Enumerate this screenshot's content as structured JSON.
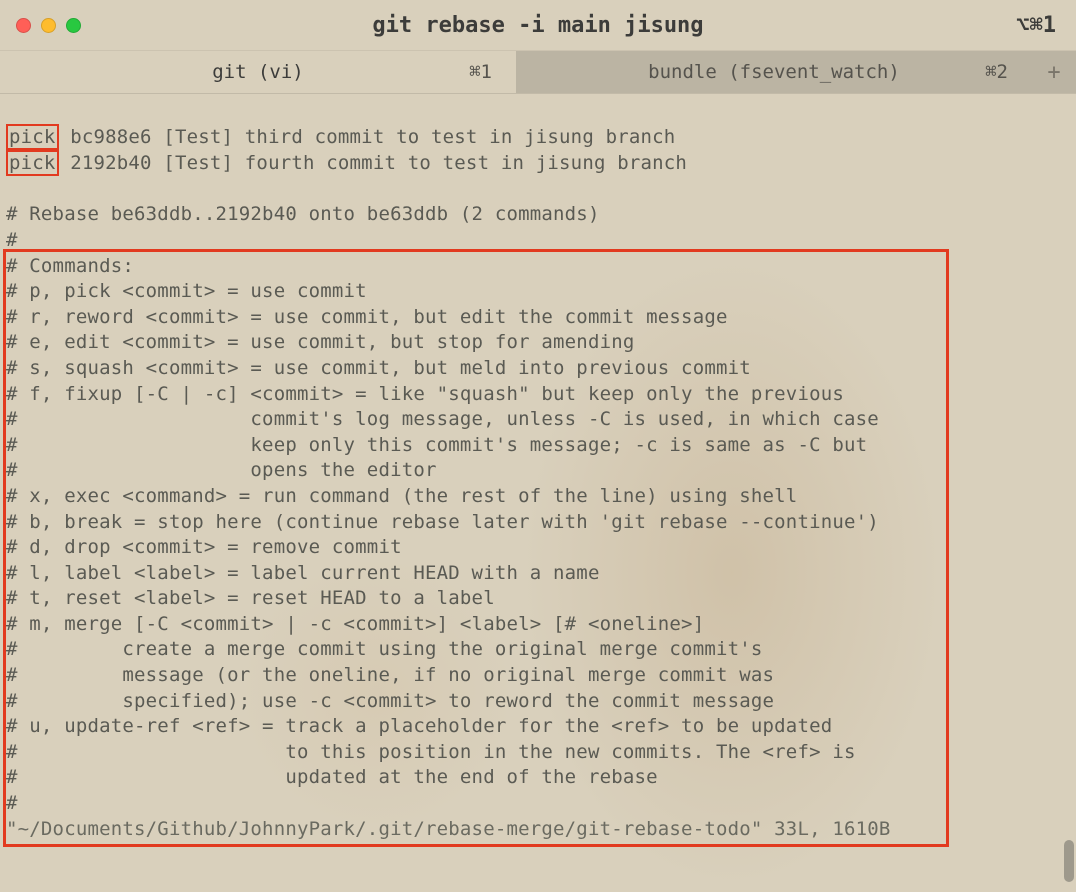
{
  "window": {
    "title": "git rebase -i main jisung",
    "right_shortcut": "⌥⌘1"
  },
  "tabs": {
    "active": {
      "label": "git (vi)",
      "shortcut": "⌘1"
    },
    "inactive": {
      "label": "bundle (fsevent_watch)",
      "shortcut": "⌘2"
    },
    "newtab_glyph": "+"
  },
  "editor": {
    "pick_label": "pick",
    "lines": {
      "l1_rest": " bc988e6 [Test] third commit to test in jisung branch",
      "l2_rest": " 2192b40 [Test] fourth commit to test in jisung branch",
      "blank": "",
      "rebase_header": "# Rebase be63ddb..2192b40 onto be63ddb (2 commands)",
      "hash": "#",
      "cmds_title": "# Commands:",
      "c_pick": "# p, pick <commit> = use commit",
      "c_reword": "# r, reword <commit> = use commit, but edit the commit message",
      "c_edit": "# e, edit <commit> = use commit, but stop for amending",
      "c_squash": "# s, squash <commit> = use commit, but meld into previous commit",
      "c_fixup1": "# f, fixup [-C | -c] <commit> = like \"squash\" but keep only the previous",
      "c_fixup2": "#                    commit's log message, unless -C is used, in which case",
      "c_fixup3": "#                    keep only this commit's message; -c is same as -C but",
      "c_fixup4": "#                    opens the editor",
      "c_exec": "# x, exec <command> = run command (the rest of the line) using shell",
      "c_break": "# b, break = stop here (continue rebase later with 'git rebase --continue')",
      "c_drop": "# d, drop <commit> = remove commit",
      "c_label": "# l, label <label> = label current HEAD with a name",
      "c_reset": "# t, reset <label> = reset HEAD to a label",
      "c_merge1": "# m, merge [-C <commit> | -c <commit>] <label> [# <oneline>]",
      "c_merge2": "#         create a merge commit using the original merge commit's",
      "c_merge3": "#         message (or the oneline, if no original merge commit was",
      "c_merge4": "#         specified); use -c <commit> to reword the commit message",
      "c_uref1": "# u, update-ref <ref> = track a placeholder for the <ref> to be updated",
      "c_uref2": "#                       to this position in the new commits. The <ref> is",
      "c_uref3": "#                       updated at the end of the rebase",
      "status": "\"~/Documents/Github/JohnnyPark/.git/rebase-merge/git-rebase-todo\" 33L, 1610B"
    }
  }
}
